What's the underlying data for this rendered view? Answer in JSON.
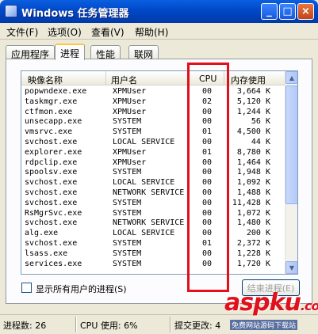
{
  "window": {
    "title": "Windows 任务管理器"
  },
  "menu": [
    {
      "label": "文件(F)"
    },
    {
      "label": "选项(O)"
    },
    {
      "label": "查看(V)"
    },
    {
      "label": "帮助(H)"
    }
  ],
  "tabs": [
    {
      "label": "应用程序"
    },
    {
      "label": "进程"
    },
    {
      "label": "性能"
    },
    {
      "label": "联网"
    }
  ],
  "columns": {
    "name": "映像名称",
    "user": "用户名",
    "cpu": "CPU",
    "mem": "内存使用"
  },
  "rows": [
    {
      "name": "popwndexe.exe",
      "user": "XPMUser",
      "cpu": "00",
      "mem": "3,664 K"
    },
    {
      "name": "taskmgr.exe",
      "user": "XPMUser",
      "cpu": "02",
      "mem": "5,120 K"
    },
    {
      "name": "ctfmon.exe",
      "user": "XPMUser",
      "cpu": "00",
      "mem": "1,244 K"
    },
    {
      "name": "unsecapp.exe",
      "user": "SYSTEM",
      "cpu": "00",
      "mem": "56 K"
    },
    {
      "name": "vmsrvc.exe",
      "user": "SYSTEM",
      "cpu": "01",
      "mem": "4,500 K"
    },
    {
      "name": "svchost.exe",
      "user": "LOCAL SERVICE",
      "cpu": "00",
      "mem": "44 K"
    },
    {
      "name": "explorer.exe",
      "user": "XPMUser",
      "cpu": "01",
      "mem": "8,780 K"
    },
    {
      "name": "rdpclip.exe",
      "user": "XPMUser",
      "cpu": "00",
      "mem": "1,464 K"
    },
    {
      "name": "spoolsv.exe",
      "user": "SYSTEM",
      "cpu": "00",
      "mem": "1,948 K"
    },
    {
      "name": "svchost.exe",
      "user": "LOCAL SERVICE",
      "cpu": "00",
      "mem": "1,092 K"
    },
    {
      "name": "svchost.exe",
      "user": "NETWORK SERVICE",
      "cpu": "00",
      "mem": "1,488 K"
    },
    {
      "name": "svchost.exe",
      "user": "SYSTEM",
      "cpu": "00",
      "mem": "11,428 K"
    },
    {
      "name": "RsMgrSvc.exe",
      "user": "SYSTEM",
      "cpu": "00",
      "mem": "1,072 K"
    },
    {
      "name": "svchost.exe",
      "user": "NETWORK SERVICE",
      "cpu": "00",
      "mem": "1,480 K"
    },
    {
      "name": "alg.exe",
      "user": "LOCAL SERVICE",
      "cpu": "00",
      "mem": "200 K"
    },
    {
      "name": "svchost.exe",
      "user": "SYSTEM",
      "cpu": "01",
      "mem": "2,372 K"
    },
    {
      "name": "lsass.exe",
      "user": "SYSTEM",
      "cpu": "00",
      "mem": "1,228 K"
    },
    {
      "name": "services.exe",
      "user": "SYSTEM",
      "cpu": "00",
      "mem": "1,720 K"
    }
  ],
  "checkbox": {
    "label": "显示所有用户的进程(S)"
  },
  "end_button": {
    "label": "结束进程(E)"
  },
  "status": {
    "processes": "进程数: 26",
    "cpu": "CPU 使用: 6%",
    "commit": "提交更改: 4"
  },
  "watermark": {
    "main": "aspku",
    "suffix": ".com",
    "sub": "免费网站源码下载站"
  },
  "colors": {
    "highlight_box": "#e0101c",
    "title_bar": "#0048c8"
  }
}
